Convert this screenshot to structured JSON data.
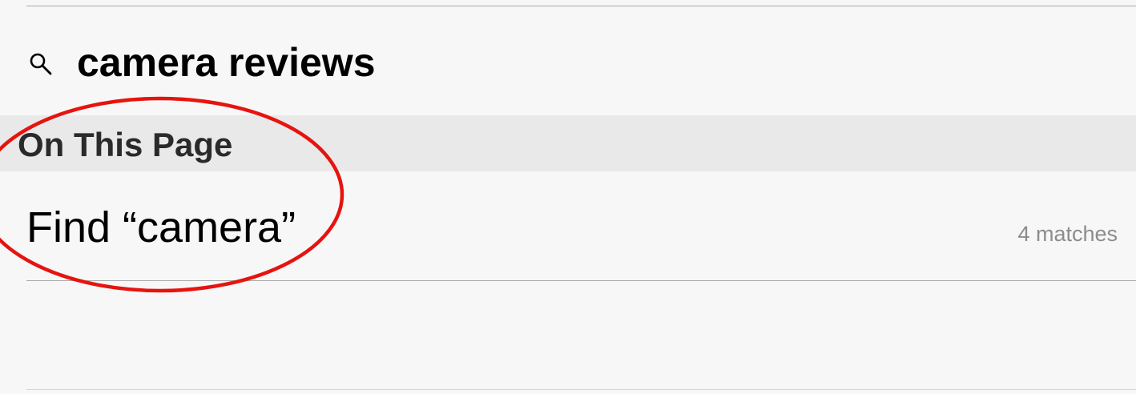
{
  "search": {
    "query": "camera reviews",
    "icon": "search-icon"
  },
  "section": {
    "title": "On This Page"
  },
  "find_result": {
    "label": "Find “camera”",
    "matches": "4 matches"
  },
  "annotation": {
    "shape": "ellipse",
    "color": "#e5140f"
  },
  "colors": {
    "background": "#f7f7f7",
    "section_header_bg": "#e9e9e9",
    "secondary_text": "#8c8c8c"
  }
}
